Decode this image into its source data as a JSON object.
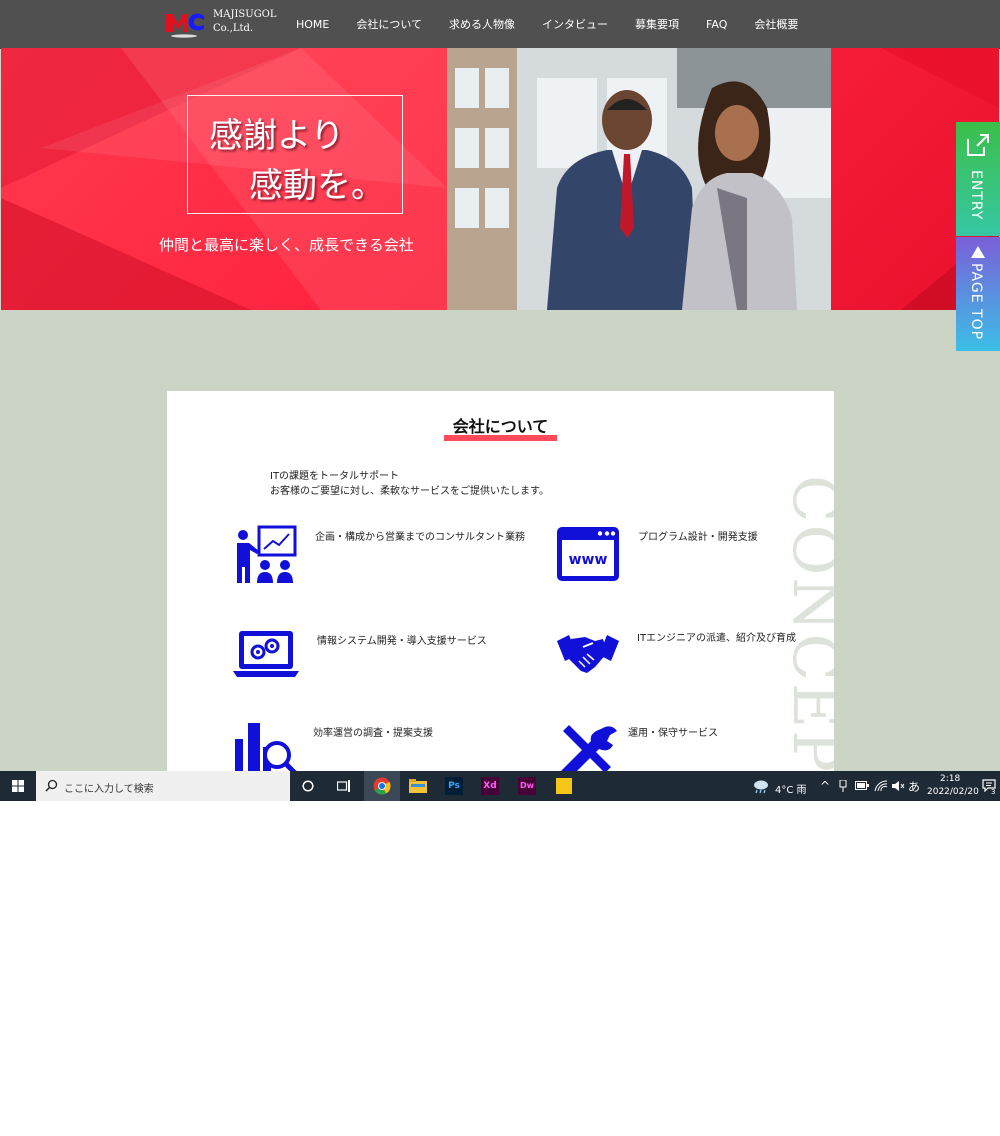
{
  "header": {
    "logo_line1": "MAJISUGOL",
    "logo_line2": "Co.,Ltd.",
    "nav": [
      "HOME",
      "会社について",
      "求める人物像",
      "インタビュー",
      "募集要項",
      "FAQ",
      "会社概要"
    ]
  },
  "hero": {
    "tagline1": "感謝より",
    "tagline2": "感動を。",
    "subtitle": "仲間と最高に楽しく、成長できる会社"
  },
  "side": {
    "entry": "ENTRY",
    "pagetop": "PAGE TOP"
  },
  "about": {
    "title": "会社について",
    "intro1": "ITの課題をトータルサポート",
    "intro2": "お客様のご要望に対し、柔軟なサービスをご提供いたします。",
    "concept": "CONCEPT",
    "services": [
      {
        "label": "企画・構成から営業までのコンサルタント業務",
        "icon": "presentation-icon"
      },
      {
        "label": "プログラム設計・開発支援",
        "icon": "www-browser-icon"
      },
      {
        "label": "情報システム開発・導入支援サービス",
        "icon": "laptop-gears-icon"
      },
      {
        "label": "ITエンジニアの派遣、紹介及び育成",
        "icon": "handshake-icon"
      },
      {
        "label": "効率運営の調査・提案支援",
        "icon": "chart-magnifier-icon"
      },
      {
        "label": "運用・保守サービス",
        "icon": "wrench-screwdriver-icon"
      }
    ]
  },
  "taskbar": {
    "search_placeholder": "ここに入力して検索",
    "weather": "4°C 雨",
    "ime": "あ",
    "time": "2:18",
    "date": "2022/02/20",
    "notification_count": "3"
  },
  "colors": {
    "accent_red": "#ff2540",
    "icon_blue": "#1010d8",
    "page_bg": "#cbd4c5",
    "header_bg": "#505050"
  }
}
